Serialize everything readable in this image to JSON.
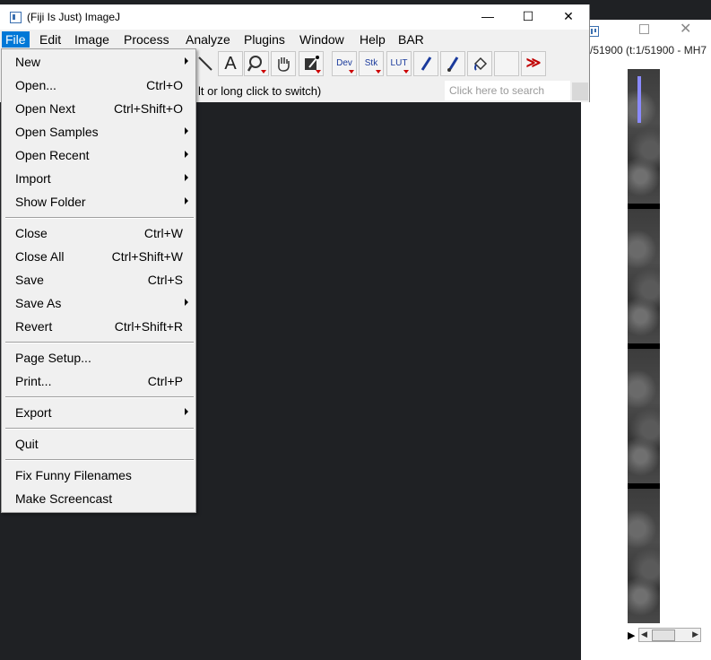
{
  "image_window": {
    "subtitle": "/51900 (t:1/51900 - MH7"
  },
  "main_window": {
    "title": "(Fiji Is Just) ImageJ",
    "minimize": "—",
    "maximize": "☐",
    "close": "✕"
  },
  "menubar": {
    "items": [
      "File",
      "Edit",
      "Image",
      "Process",
      "Analyze",
      "Plugins",
      "Window",
      "Help",
      "BAR"
    ]
  },
  "toolbar": {
    "tools": [
      {
        "icon": "wand-icon"
      },
      {
        "icon": "text-tool-icon",
        "glyph": "A"
      },
      {
        "icon": "magnifier-icon"
      },
      {
        "icon": "hand-icon"
      },
      {
        "icon": "color-picker-icon"
      },
      {
        "icon": "dev-icon",
        "label": "Dev"
      },
      {
        "icon": "stack-icon",
        "label": "Stk"
      },
      {
        "icon": "lut-icon",
        "label": "LUT"
      },
      {
        "icon": "pencil-icon"
      },
      {
        "icon": "brush-icon"
      },
      {
        "icon": "flood-fill-icon"
      },
      {
        "icon": "blank-tool-icon"
      },
      {
        "icon": "more-tools-icon",
        "glyph": "≫"
      }
    ]
  },
  "status": {
    "text": "lt or long click to switch)",
    "search_placeholder": "Click here to search"
  },
  "file_menu": {
    "groups": [
      [
        {
          "label": "New",
          "submenu": true
        },
        {
          "label": "Open...",
          "shortcut": "Ctrl+O"
        },
        {
          "label": "Open Next",
          "shortcut": "Ctrl+Shift+O"
        },
        {
          "label": "Open Samples",
          "submenu": true
        },
        {
          "label": "Open Recent",
          "submenu": true
        },
        {
          "label": "Import",
          "submenu": true
        },
        {
          "label": "Show Folder",
          "submenu": true
        }
      ],
      [
        {
          "label": "Close",
          "shortcut": "Ctrl+W"
        },
        {
          "label": "Close All",
          "shortcut": "Ctrl+Shift+W"
        },
        {
          "label": "Save",
          "shortcut": "Ctrl+S"
        },
        {
          "label": "Save As",
          "submenu": true
        },
        {
          "label": "Revert",
          "shortcut": "Ctrl+Shift+R"
        }
      ],
      [
        {
          "label": "Page Setup..."
        },
        {
          "label": "Print...",
          "shortcut": "Ctrl+P"
        }
      ],
      [
        {
          "label": "Export",
          "submenu": true
        }
      ],
      [
        {
          "label": "Quit"
        }
      ],
      [
        {
          "label": "Fix Funny Filenames"
        },
        {
          "label": "Make Screencast"
        }
      ]
    ]
  },
  "colors": {
    "menu_highlight": "#0078d7",
    "desktop": "#1f2124",
    "more_tools_red": "#c00000"
  }
}
